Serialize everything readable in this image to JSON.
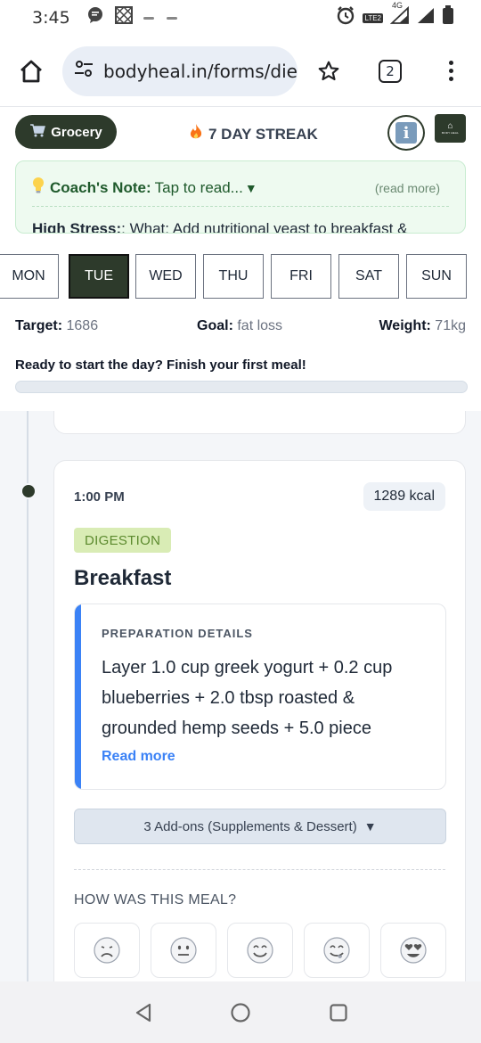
{
  "status_bar": {
    "time": "3:45",
    "network": "4G",
    "volte": "LTE2"
  },
  "browser": {
    "url": "bodyheal.in/forms/die",
    "tab_count": "2"
  },
  "header": {
    "grocery_label": "Grocery",
    "streak_label": "7 DAY STREAK",
    "info_label": "i",
    "logo_text": "BODY HEAL"
  },
  "coach": {
    "title": "Coach's Note:",
    "tap_text": "Tap to read...",
    "read_more": "(read more)",
    "stress_label": "High Stress:",
    "stress_text": ": What: Add nutritional yeast to breakfast &"
  },
  "days": [
    {
      "label": "MON",
      "active": false
    },
    {
      "label": "TUE",
      "active": true
    },
    {
      "label": "WED",
      "active": false
    },
    {
      "label": "THU",
      "active": false
    },
    {
      "label": "FRI",
      "active": false
    },
    {
      "label": "SAT",
      "active": false
    },
    {
      "label": "SUN",
      "active": false
    }
  ],
  "stats": {
    "target_label": "Target:",
    "target_value": "1686",
    "goal_label": "Goal:",
    "goal_value": "fat loss",
    "weight_label": "Weight:",
    "weight_value": "71kg"
  },
  "progress": {
    "message": "Ready to start the day? Finish your first meal!",
    "fraction": 0
  },
  "meal": {
    "time": "1:00 PM",
    "kcal": "1289 kcal",
    "tag": "DIGESTION",
    "name": "Breakfast",
    "prep_title": "PREPARATION DETAILS",
    "prep_text": "Layer 1.0 cup greek yogurt + 0.2 cup blueberries + 2.0 tbsp roasted & grounded hemp seeds + 5.0 piece",
    "read_more": "Read more",
    "addons_label": "3 Add-ons (Supplements & Dessert)",
    "rating_prompt": "HOW WAS THIS MEAL?",
    "ratings": [
      "sad-face",
      "neutral-face",
      "smiling-face",
      "savoring-face",
      "heart-eyes-face"
    ]
  },
  "colors": {
    "brand_dark": "#2d3a2b",
    "accent_blue": "#3b82f6",
    "coach_bg": "#eefaf0",
    "tag_bg": "#d9ecb5"
  }
}
